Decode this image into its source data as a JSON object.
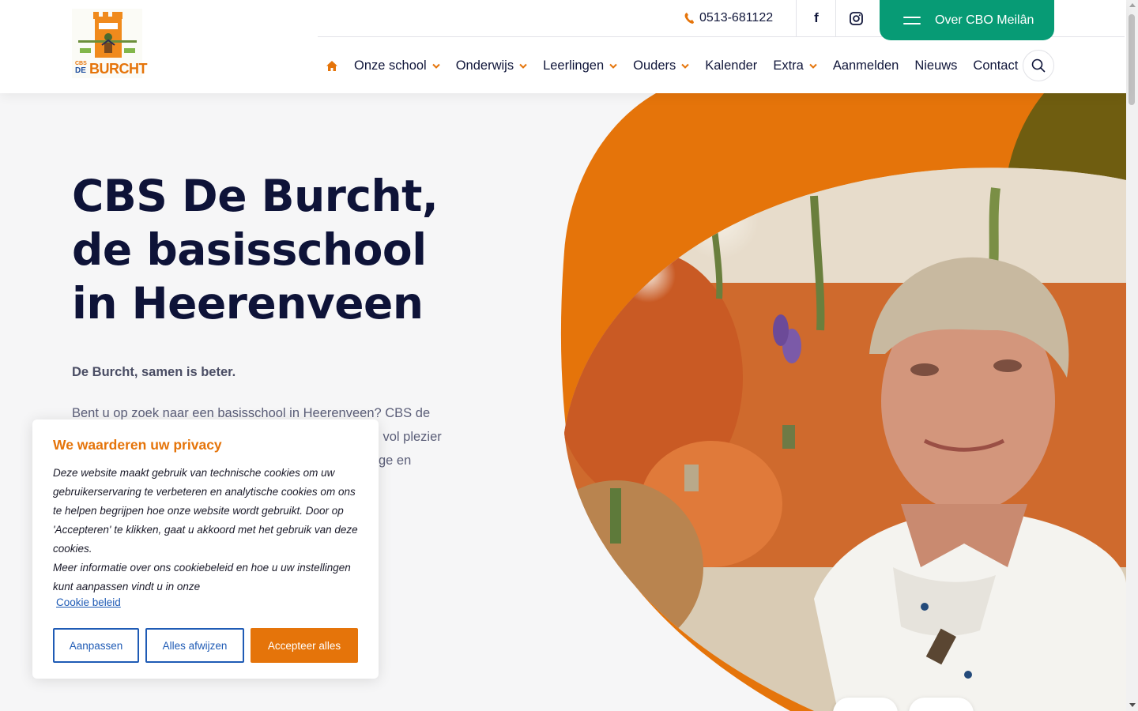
{
  "header": {
    "logo_text_top": "CBS",
    "logo_text_de": "DE",
    "logo_text_main": "BURCHT",
    "phone": "0513-681122",
    "over_button": "Over CBO Meilân"
  },
  "nav": {
    "items": [
      {
        "label": "Onze school",
        "dropdown": true
      },
      {
        "label": "Onderwijs",
        "dropdown": true
      },
      {
        "label": "Leerlingen",
        "dropdown": true
      },
      {
        "label": "Ouders",
        "dropdown": true
      },
      {
        "label": "Kalender",
        "dropdown": false
      },
      {
        "label": "Extra",
        "dropdown": true
      },
      {
        "label": "Aanmelden",
        "dropdown": false
      },
      {
        "label": "Nieuws",
        "dropdown": false
      },
      {
        "label": "Contact",
        "dropdown": false
      }
    ]
  },
  "hero": {
    "title": "CBS De Burcht, de basisschool in Heerenveen",
    "subtitle": "De Burcht, samen is beter.",
    "body": "Bent u op zoek naar een basisschool in Heerenveen? CBS de Burcht is een plek waar kinderen zich thuis voelen en vol plezier en betekenisvol leren. Wij zetten ons in voor een veilige en inspirerende leeromgeving voor alle kinderen,"
  },
  "cookie": {
    "title": "We waarderen uw privacy",
    "text_1": " Deze website maakt gebruik van technische cookies om uw gebruikerservaring te verbeteren en analytische cookies om ons te helpen begrijpen hoe onze website wordt gebruikt. Door op 'Accepteren' te klikken, gaat u akkoord met het gebruik van deze cookies.",
    "text_2": "Meer informatie over ons cookiebeleid en hoe u uw instellingen kunt aanpassen vindt u in onze",
    "link": "Cookie beleid",
    "btn_customize": "Aanpassen",
    "btn_reject": "Alles afwijzen",
    "btn_accept": "Accepteer alles"
  },
  "colors": {
    "brand_orange": "#e5740a",
    "brand_green": "#079b75",
    "navy": "#0e1338",
    "link_blue": "#1f5bb5"
  },
  "icons": {
    "home": "home-icon",
    "phone": "phone-icon",
    "facebook": "facebook-icon",
    "instagram": "instagram-icon",
    "search": "search-icon",
    "menu": "hamburger-icon"
  }
}
